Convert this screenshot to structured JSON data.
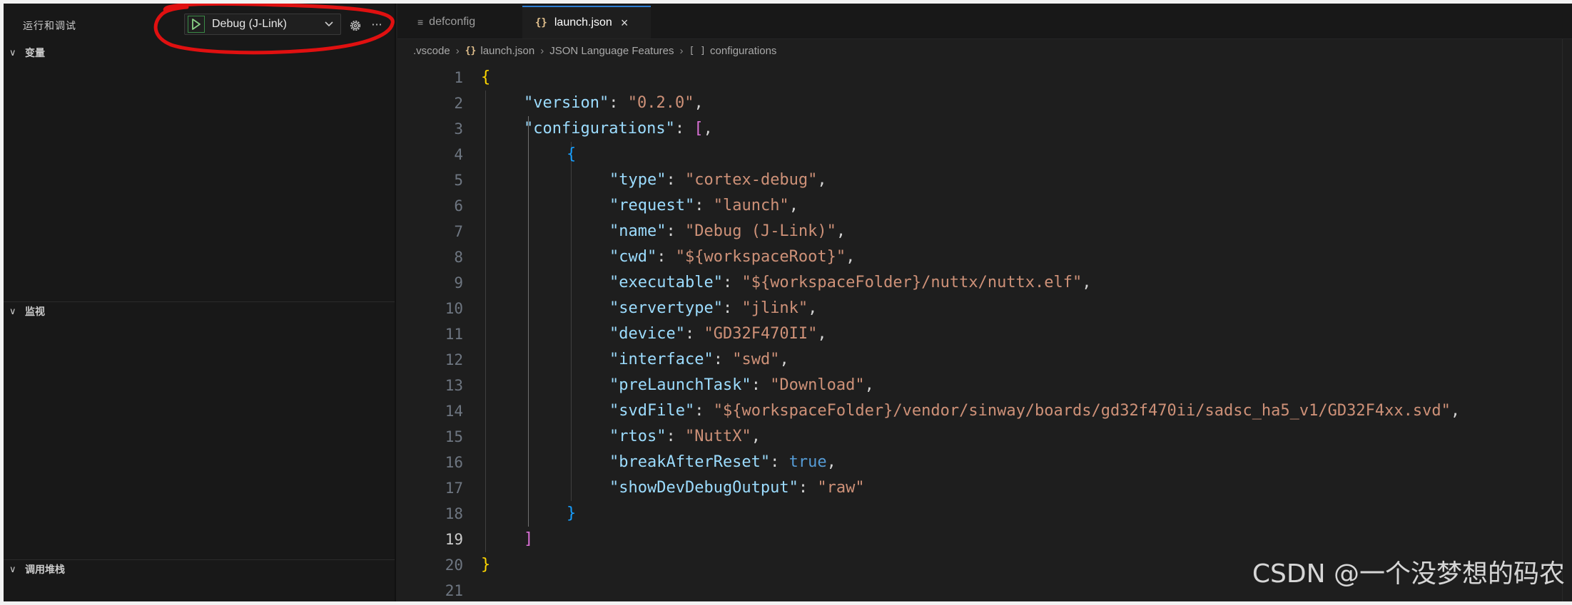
{
  "sidebar": {
    "title": "运行和调试",
    "debug_config": "Debug (J-Link)",
    "more_label": "···",
    "sections": [
      {
        "label": "变量"
      },
      {
        "label": "监视"
      },
      {
        "label": "调用堆栈"
      }
    ]
  },
  "tabs": [
    {
      "label": "defconfig",
      "icon": "lines-file-icon",
      "active": false
    },
    {
      "label": "launch.json",
      "icon": "json-braces-icon",
      "active": true
    }
  ],
  "breadcrumb": {
    "items": [
      ".vscode",
      "launch.json",
      "JSON Language Features",
      "configurations"
    ],
    "braces_glyph": "{}",
    "array_glyph": "[ ]"
  },
  "editor": {
    "active_line": 19,
    "lines": [
      {
        "n": "1"
      },
      {
        "n": "2",
        "key": "\"version\"",
        "val": "\"0.2.0\""
      },
      {
        "n": "3",
        "key": "\"configurations\""
      },
      {
        "n": "4"
      },
      {
        "n": "5",
        "key": "\"type\"",
        "val": "\"cortex-debug\""
      },
      {
        "n": "6",
        "key": "\"request\"",
        "val": "\"launch\""
      },
      {
        "n": "7",
        "key": "\"name\"",
        "val": "\"Debug (J-Link)\""
      },
      {
        "n": "8",
        "key": "\"cwd\"",
        "val": "\"${workspaceRoot}\""
      },
      {
        "n": "9",
        "key": "\"executable\"",
        "val": "\"${workspaceFolder}/nuttx/nuttx.elf\""
      },
      {
        "n": "10",
        "key": "\"servertype\"",
        "val": "\"jlink\""
      },
      {
        "n": "11",
        "key": "\"device\"",
        "val": "\"GD32F470II\""
      },
      {
        "n": "12",
        "key": "\"interface\"",
        "val": "\"swd\""
      },
      {
        "n": "13",
        "key": "\"preLaunchTask\"",
        "val": "\"Download\""
      },
      {
        "n": "14",
        "key": "\"svdFile\"",
        "val": "\"${workspaceFolder}/vendor/sinway/boards/gd32f470ii/sadsc_ha5_v1/GD32F4xx.svd\""
      },
      {
        "n": "15",
        "key": "\"rtos\"",
        "val": "\"NuttX\""
      },
      {
        "n": "16",
        "key": "\"breakAfterReset\"",
        "val": "true"
      },
      {
        "n": "17",
        "key": "\"showDevDebugOutput\"",
        "val": "\"raw\""
      },
      {
        "n": "18"
      },
      {
        "n": "19"
      },
      {
        "n": "20"
      },
      {
        "n": "21"
      }
    ]
  },
  "watermark": "CSDN @一个没梦想的码农",
  "colors": {
    "key": "#9cdcfe",
    "string": "#ce9178",
    "keyword": "#569cd6",
    "bracket_level1": "#ffd700",
    "bracket_level2": "#da70d6",
    "bracket_level3": "#179fff",
    "annotation_red": "#e01010"
  }
}
